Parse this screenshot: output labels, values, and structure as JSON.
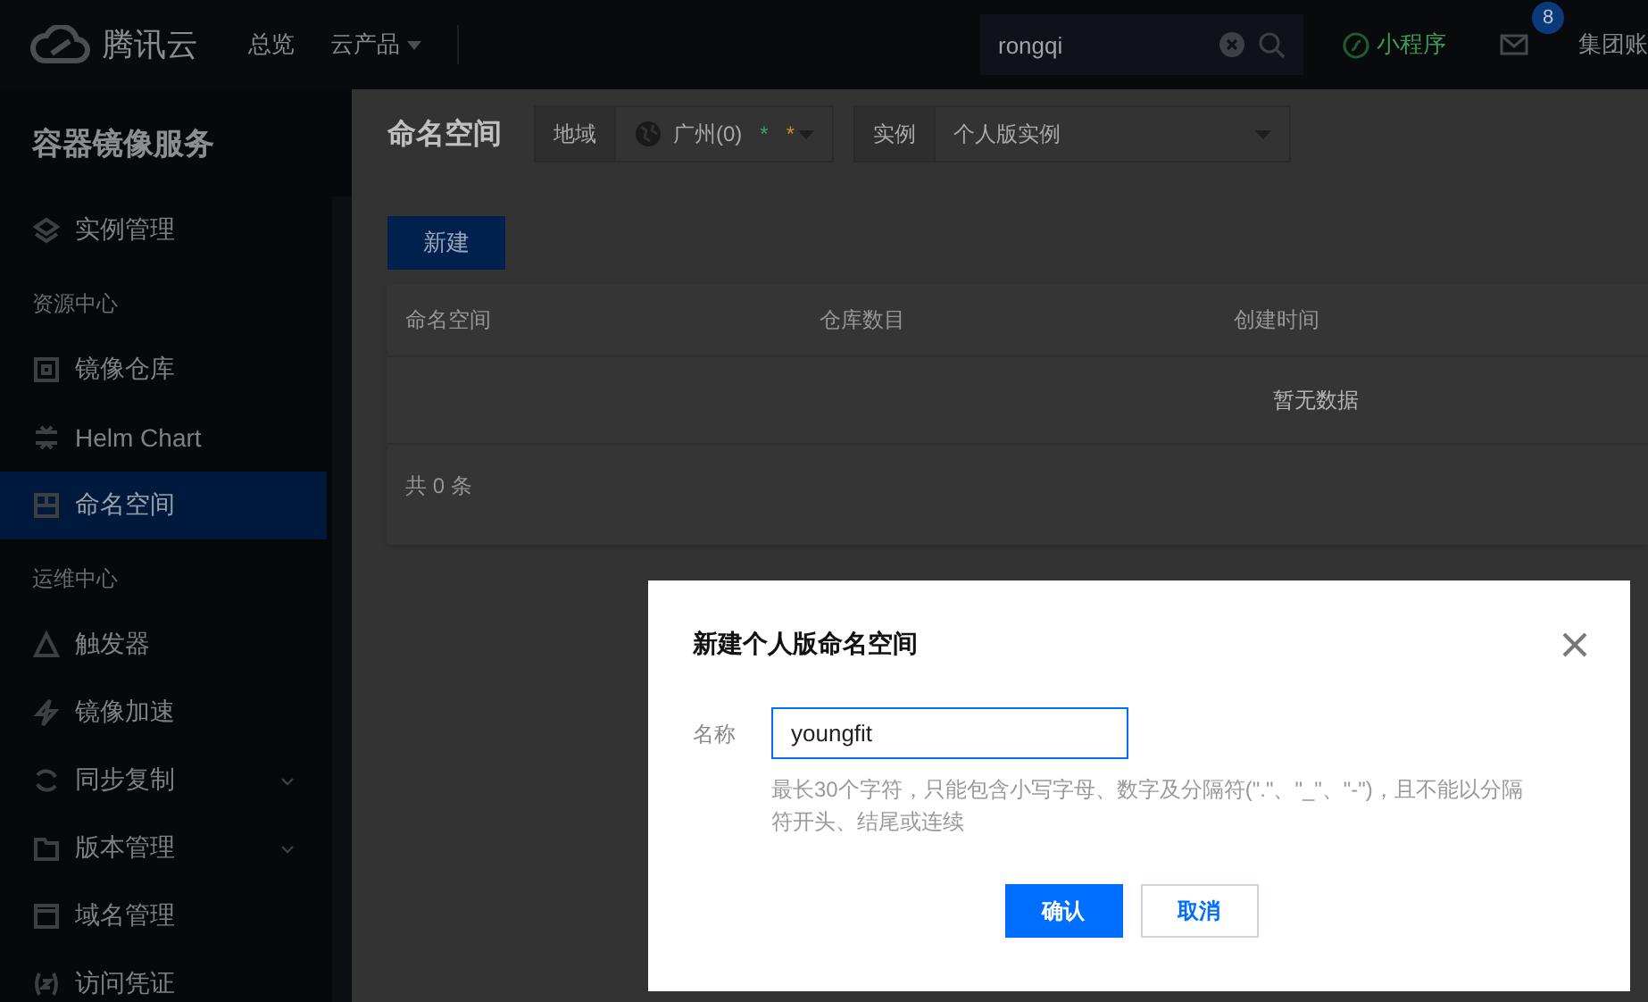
{
  "topbar": {
    "brand": "腾讯云",
    "nav": [
      {
        "label": "总览",
        "dropdown": false
      },
      {
        "label": "云产品",
        "dropdown": true
      }
    ],
    "search": {
      "value": "rongqi"
    },
    "mini_program": "小程序",
    "mail_badge": "8",
    "account": "集团账"
  },
  "sidebar": {
    "title": "容器镜像服务",
    "items": [
      {
        "kind": "item",
        "label": "实例管理",
        "selected": false,
        "has_submenu": false
      },
      {
        "kind": "section",
        "label": "资源中心"
      },
      {
        "kind": "item",
        "label": "镜像仓库",
        "selected": false,
        "has_submenu": false
      },
      {
        "kind": "item",
        "label": "Helm Chart",
        "selected": false,
        "has_submenu": false
      },
      {
        "kind": "item",
        "label": "命名空间",
        "selected": true,
        "has_submenu": false
      },
      {
        "kind": "section",
        "label": "运维中心"
      },
      {
        "kind": "item",
        "label": "触发器",
        "selected": false,
        "has_submenu": false
      },
      {
        "kind": "item",
        "label": "镜像加速",
        "selected": false,
        "has_submenu": false
      },
      {
        "kind": "item",
        "label": "同步复制",
        "selected": false,
        "has_submenu": true
      },
      {
        "kind": "item",
        "label": "版本管理",
        "selected": false,
        "has_submenu": true
      },
      {
        "kind": "item",
        "label": "域名管理",
        "selected": false,
        "has_submenu": false
      },
      {
        "kind": "item",
        "label": "访问凭证",
        "selected": false,
        "has_submenu": false
      }
    ]
  },
  "main": {
    "title": "命名空间",
    "filters": [
      {
        "label": "地域",
        "value": "广州(0)",
        "globe": true,
        "marks": [
          {
            "text": "*",
            "color": "#3fa060"
          },
          {
            "text": "*",
            "color": "#d08a30"
          }
        ]
      },
      {
        "label": "实例",
        "value": "个人版实例",
        "globe": false
      }
    ],
    "new_button": "新建",
    "table": {
      "columns": [
        "命名空间",
        "仓库数目",
        "创建时间"
      ],
      "empty": "暂无数据",
      "footer": "共 0 条"
    }
  },
  "dialog": {
    "title": "新建个人版命名空间",
    "field": {
      "label": "名称",
      "value": "youngfit",
      "focused": true,
      "hint": "最长30个字符，只能包含小写字母、数字及分隔符(\".\"、\"_\"、\"-\")，且不能以分隔符开头、结尾或连续"
    },
    "buttons": [
      {
        "label": "确认",
        "kind": "primary"
      },
      {
        "label": "取消",
        "kind": "secondary"
      }
    ]
  }
}
